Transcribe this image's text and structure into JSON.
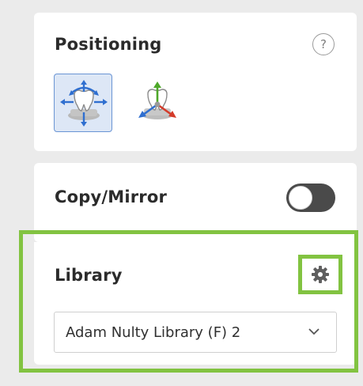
{
  "positioning": {
    "title": "Positioning",
    "help_label": "?",
    "tools": [
      {
        "name": "move-rotate-tool",
        "icon": "tooth-move-arrows-icon",
        "active": true
      },
      {
        "name": "axis-tool",
        "icon": "tooth-xyz-axes-icon",
        "active": false
      }
    ]
  },
  "copy_mirror": {
    "title": "Copy/Mirror",
    "toggle_state": "off"
  },
  "library": {
    "title": "Library",
    "settings_icon": "gear-icon",
    "selected": "Adam Nulty Library (F) 2",
    "chevron_icon": "chevron-down-icon"
  },
  "colors": {
    "highlight": "#82c341",
    "active_tool_bg": "#dde7f6",
    "active_tool_border": "#6a95d4",
    "toggle_track": "#4a4a4a"
  }
}
